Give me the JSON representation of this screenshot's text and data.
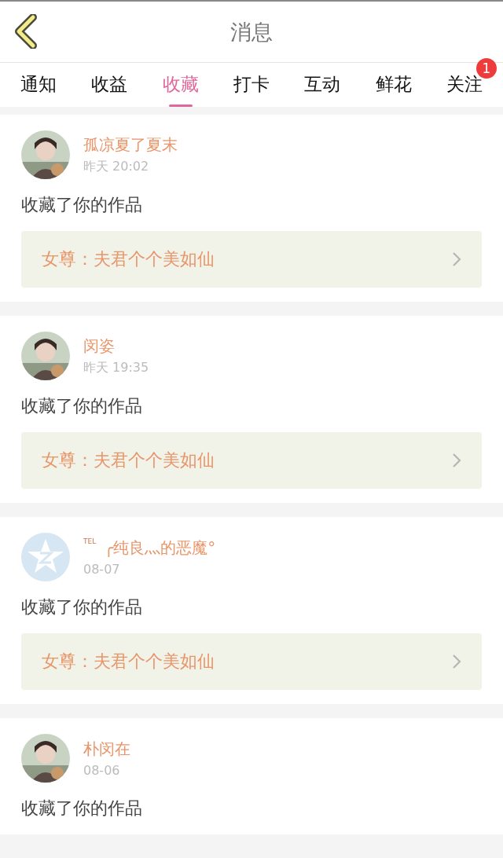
{
  "header": {
    "title": "消息"
  },
  "tabs": [
    {
      "label": "通知",
      "selected": false
    },
    {
      "label": "收益",
      "selected": false
    },
    {
      "label": "收藏",
      "selected": true
    },
    {
      "label": "打卡",
      "selected": false
    },
    {
      "label": "互动",
      "selected": false
    },
    {
      "label": "鲜花",
      "selected": false
    },
    {
      "label": "关注",
      "selected": false,
      "badge": "1"
    }
  ],
  "messages": [
    {
      "name": "孤凉夏了夏末",
      "time": "昨天 20:02",
      "text": "收藏了你的作品",
      "work": "女尊：夫君个个美如仙"
    },
    {
      "name": "闵姿",
      "time": "昨天 19:35",
      "text": "收藏了你的作品",
      "work": "女尊：夫君个个美如仙"
    },
    {
      "avatar": {
        "kind": "default"
      },
      "name_tag": "TEL",
      "name": "╭纯良灬的恶魔°",
      "time": "08-07",
      "text": "收藏了你的作品",
      "work": "女尊：夫君个个美如仙"
    },
    {
      "name": "朴闵在",
      "time": "08-06",
      "text": "收藏了你的作品"
    }
  ]
}
